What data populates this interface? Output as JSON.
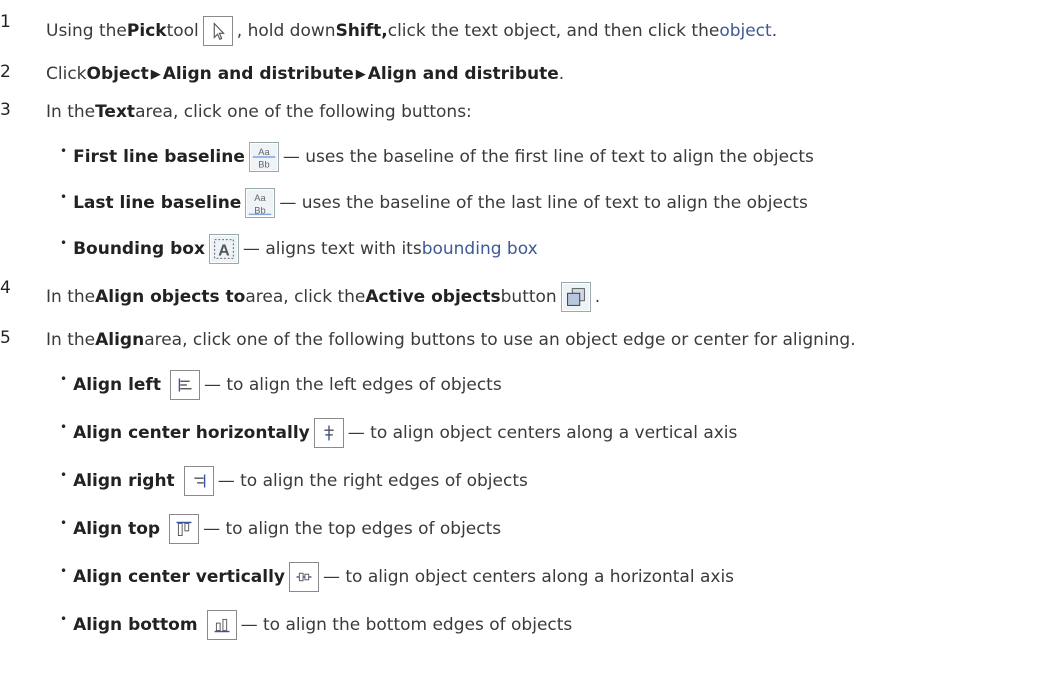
{
  "steps": [
    {
      "number": "1",
      "parts": {
        "a": "Using the ",
        "b": "Pick",
        "c": " tool ",
        "d": ", hold down ",
        "e": "Shift,",
        "f": " click the text object, and then click the ",
        "g": "object",
        "h": "."
      }
    },
    {
      "number": "2",
      "parts": {
        "a": "Click ",
        "b": "Object",
        "c": "Align and distribute",
        "d": "Align and distribute",
        "e": "."
      }
    },
    {
      "number": "3",
      "parts": {
        "a": "In the ",
        "b": "Text",
        "c": " area, click one of the following buttons:"
      },
      "items": [
        {
          "label": "First line baseline",
          "desc": " — uses the baseline of the first line of text to align the objects",
          "icon": "text-baseline-icon"
        },
        {
          "label": "Last line baseline",
          "desc": " — uses the baseline of the last line of text to align the objects",
          "icon": "text-baseline-icon"
        },
        {
          "label": "Bounding box",
          "desc_a": " — aligns text with its ",
          "desc_link": "bounding box",
          "icon": "bounding-box-icon"
        }
      ]
    },
    {
      "number": "4",
      "parts": {
        "a": "In the ",
        "b": "Align objects to",
        "c": " area, click the ",
        "d": "Active objects",
        "e": " button ",
        "f": "."
      }
    },
    {
      "number": "5",
      "parts": {
        "a": "In the ",
        "b": "Align",
        "c": " area, click one of the following buttons to use an object edge or center for aligning."
      },
      "items": [
        {
          "label": "Align left",
          "desc": " — to align the left edges of objects",
          "icon": "align-left-icon"
        },
        {
          "label": "Align center horizontally",
          "desc": " — to align object centers along a vertical axis",
          "icon": "align-center-horizontal-icon"
        },
        {
          "label": "Align right",
          "desc": " — to align the right edges of objects",
          "icon": "align-right-icon"
        },
        {
          "label": "Align top",
          "desc": " — to align the top edges of objects",
          "icon": "align-top-icon"
        },
        {
          "label": "Align center vertically",
          "desc": " — to align object centers along a horizontal axis",
          "icon": "align-center-vertical-icon"
        },
        {
          "label": "Align bottom",
          "desc": " — to align the bottom edges of objects",
          "icon": "align-bottom-icon"
        }
      ]
    }
  ],
  "bullet_glyph": "•",
  "arrow_glyph": "▶",
  "colors": {
    "link": "#3d5a96",
    "text": "#3a3a3a"
  }
}
